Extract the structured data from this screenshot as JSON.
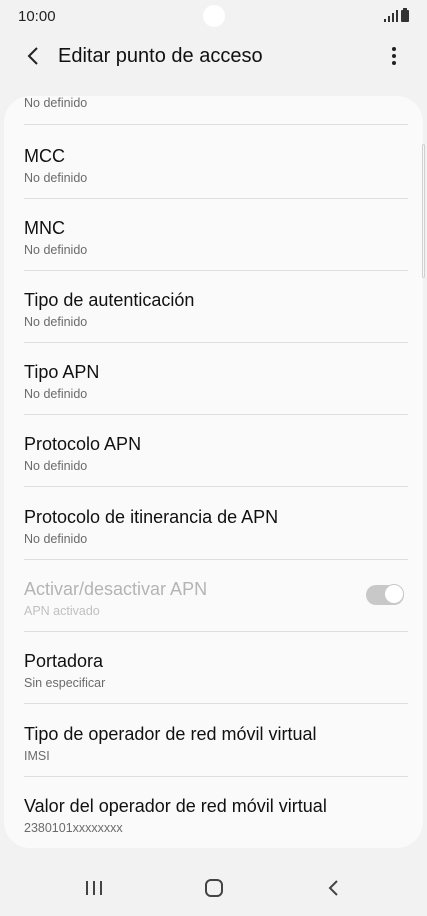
{
  "status_bar": {
    "time": "10:00"
  },
  "app_bar": {
    "title": "Editar punto de acceso"
  },
  "items": [
    {
      "title": "",
      "subtitle": "No definido"
    },
    {
      "title": "MCC",
      "subtitle": "No definido"
    },
    {
      "title": "MNC",
      "subtitle": "No definido"
    },
    {
      "title": "Tipo de autenticación",
      "subtitle": "No definido"
    },
    {
      "title": "Tipo APN",
      "subtitle": "No definido"
    },
    {
      "title": "Protocolo APN",
      "subtitle": "No definido"
    },
    {
      "title": "Protocolo de itinerancia de APN",
      "subtitle": "No definido"
    },
    {
      "title": "Activar/desactivar APN",
      "subtitle": "APN activado",
      "toggle_on": true,
      "enabled": false
    },
    {
      "title": "Portadora",
      "subtitle": "Sin especificar"
    },
    {
      "title": "Tipo de operador de red móvil virtual",
      "subtitle": "IMSI"
    },
    {
      "title": "Valor del operador de red móvil virtual",
      "subtitle": "2380101xxxxxxxx"
    }
  ],
  "icons": {
    "back": "chevron-left-icon",
    "more": "more-vertical-icon",
    "nav_recents": "recent-apps-icon",
    "nav_home": "home-icon",
    "nav_back": "back-icon"
  },
  "colors": {
    "background": "#f2f2f2",
    "card": "#fafafa",
    "toggle_disabled": "#c8c8c8"
  }
}
